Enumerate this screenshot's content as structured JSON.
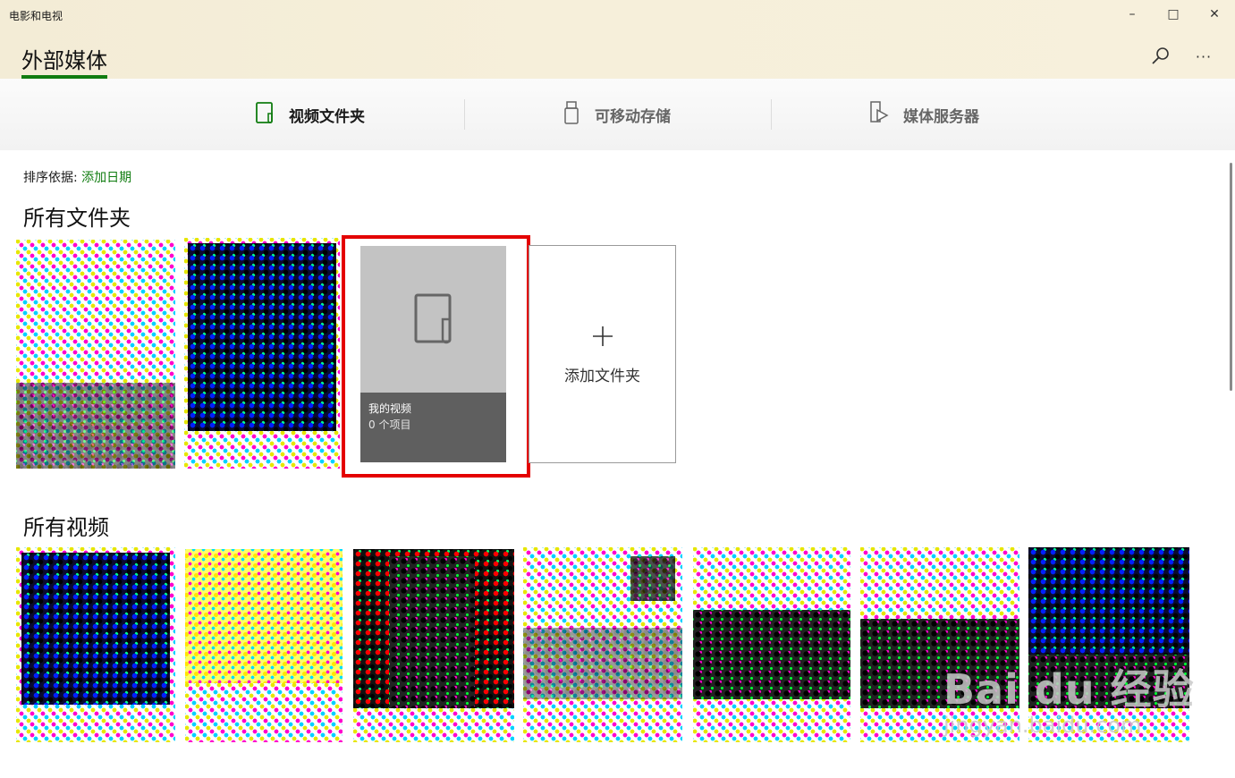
{
  "window": {
    "app_title": "电影和电视",
    "minimize": "–",
    "maximize": "□",
    "close": "✕"
  },
  "header": {
    "page_title": "外部媒体",
    "search_icon": "search-icon",
    "more": "···"
  },
  "tabs": [
    {
      "label": "视频文件夹",
      "icon": "folder-video-icon",
      "active": true
    },
    {
      "label": "可移动存储",
      "icon": "usb-drive-icon",
      "active": false
    },
    {
      "label": "媒体服务器",
      "icon": "media-server-icon",
      "active": false
    }
  ],
  "sort": {
    "label": "排序依据:",
    "value": "添加日期"
  },
  "folders_section": {
    "title": "所有文件夹",
    "folder_card": {
      "name": "我的视频",
      "count": "0 个项目"
    },
    "add_folder": {
      "plus": "+",
      "label": "添加文件夹"
    }
  },
  "videos_section": {
    "title": "所有视频"
  },
  "watermark": {
    "line1": "Bai du 经验",
    "line2": "jingyan.baidu.com"
  },
  "colors": {
    "accent": "#107c10",
    "highlight": "#e40000",
    "caption_bg": "#5f5f5f",
    "card_bg": "#c3c3c3"
  }
}
